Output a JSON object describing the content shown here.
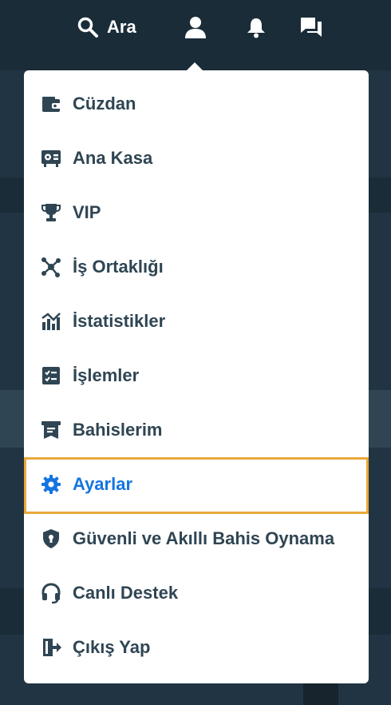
{
  "topbar": {
    "search_label": "Ara",
    "icons": [
      "search-icon",
      "user-icon",
      "bell-icon",
      "chat-icon"
    ]
  },
  "menu": {
    "items": [
      {
        "label": "Cüzdan",
        "icon": "wallet-icon"
      },
      {
        "label": "Ana Kasa",
        "icon": "vault-icon"
      },
      {
        "label": "VIP",
        "icon": "trophy-icon"
      },
      {
        "label": "İş Ortaklığı",
        "icon": "affiliate-icon"
      },
      {
        "label": "İstatistikler",
        "icon": "statistics-icon"
      },
      {
        "label": "İşlemler",
        "icon": "transactions-icon"
      },
      {
        "label": "Bahislerim",
        "icon": "bets-icon"
      },
      {
        "label": "Ayarlar",
        "icon": "settings-icon",
        "active": true
      },
      {
        "label": "Güvenli ve Akıllı Bahis Oynama",
        "icon": "shield-icon"
      },
      {
        "label": "Canlı Destek",
        "icon": "headset-icon"
      },
      {
        "label": "Çıkış Yap",
        "icon": "logout-icon"
      }
    ]
  },
  "colors": {
    "topbar": "#1a2c38",
    "text": "#2f4553",
    "active": "#1475e1",
    "highlight": "#e8a93a"
  }
}
